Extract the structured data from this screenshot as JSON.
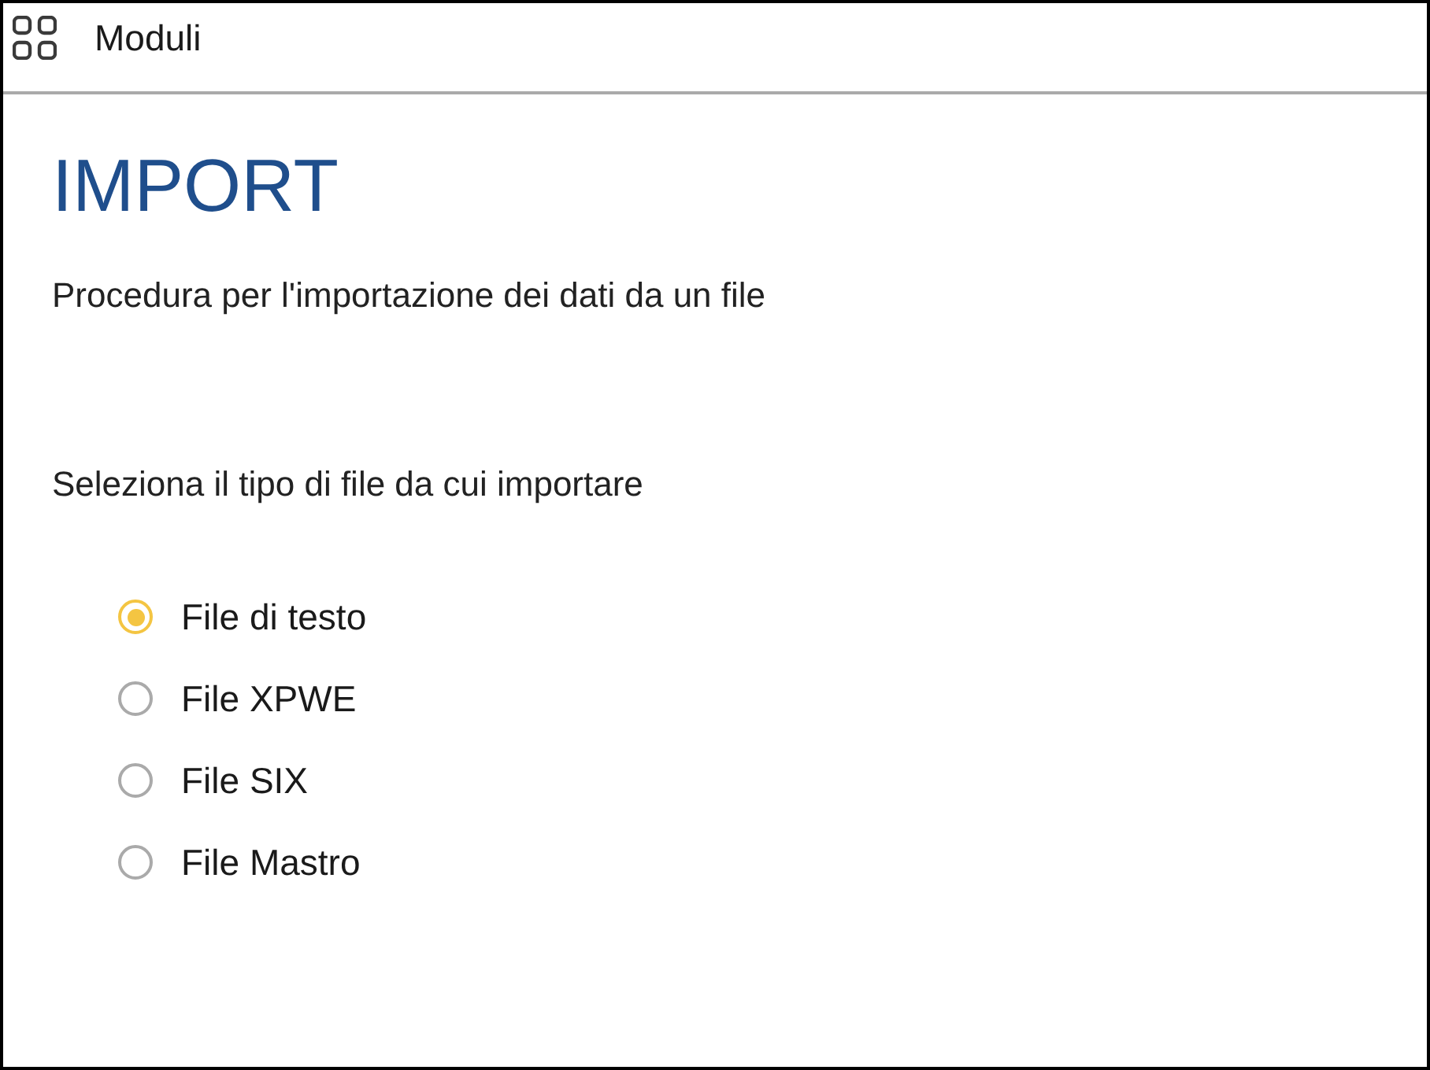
{
  "header": {
    "title": "Moduli"
  },
  "page": {
    "title": "IMPORT",
    "description": "Procedura per l'importazione dei dati da un file"
  },
  "file_type": {
    "prompt": "Seleziona il tipo di file da cui importare",
    "options": [
      {
        "label": "File di testo",
        "selected": true
      },
      {
        "label": "File XPWE",
        "selected": false
      },
      {
        "label": "File SIX",
        "selected": false
      },
      {
        "label": "File Mastro",
        "selected": false
      }
    ]
  }
}
